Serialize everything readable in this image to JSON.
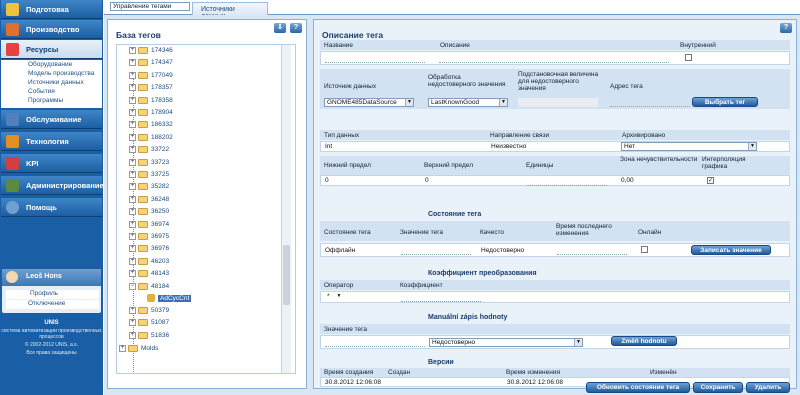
{
  "nav": {
    "items": [
      {
        "label": "Подготовка",
        "icon": "clipboard-icon",
        "color": "#f0c040"
      },
      {
        "label": "Производство",
        "icon": "tools-icon",
        "color": "#e07030"
      },
      {
        "label": "Ресурсы",
        "icon": "resources-icon",
        "color": "#e84040"
      },
      {
        "label": "Обслуживание",
        "icon": "service-icon",
        "color": "#5080c0"
      },
      {
        "label": "Технология",
        "icon": "technology-icon",
        "color": "#e09020"
      },
      {
        "label": "KPI",
        "icon": "kpi-icon",
        "color": "#d04040"
      },
      {
        "label": "Администрирование",
        "icon": "admin-icon",
        "color": "#5a8a40"
      },
      {
        "label": "Помощь",
        "icon": "help-icon",
        "color": "#6fa0d0"
      }
    ],
    "sub_items": [
      "Оборудование",
      "Модель производства",
      "Источники данных",
      "События",
      "Программы"
    ],
    "user": {
      "name": "Leoš Hons",
      "profile": "Профиль",
      "logout": "Отключение"
    },
    "footer": [
      "система автоматизации производственных процессов",
      "© 2002-2012 UNIS, a.s.",
      "Все права защищены"
    ]
  },
  "tabs": [
    "Управление тегами",
    "Источники данных"
  ],
  "tree": {
    "title": "База тегов",
    "nodes": [
      "174346",
      "174347",
      "177049",
      "178357",
      "178358",
      "178904",
      "186332",
      "188202",
      "33722",
      "33723",
      "33725",
      "35282",
      "36248",
      "36250",
      "36974",
      "36975",
      "36976",
      "46203",
      "48143",
      "48184",
      "50379",
      "51087",
      "51836"
    ],
    "child": "AdCycCnt",
    "last": "Molds"
  },
  "form": {
    "title": "Описание тега",
    "h_name": "Название",
    "h_desc": "Описание",
    "h_internal": "Внутренний",
    "h_source": "Источник данных",
    "h_invalid": "Обработка недостоверного значения",
    "h_substitute": "Подстановочная величина для недостоверного значения",
    "h_address": "Адрес тега",
    "source": "GNOME485DataSource",
    "invalid": "LastKnownGood",
    "select_tag": "Выбрать тег",
    "h_type": "Тип данных",
    "h_dir": "Направление связи",
    "h_arch": "Архивировано",
    "type": "Int",
    "dir": "Неизвестно",
    "arch": "Нет",
    "h_low": "Нижний предел",
    "h_high": "Верхний предел",
    "h_units": "Единицы",
    "h_dead": "Зона нечувствительности",
    "h_interp": "Интерполяция графика",
    "low": "0",
    "high": "0",
    "dead": "0,00",
    "state_title": "Состояние тега",
    "h_state": "Состояние тега",
    "h_value": "Значение тега",
    "h_quality": "Качесто",
    "h_last": "Время последнего изменения",
    "h_online": "Онлайн",
    "state": "Оффлайн",
    "quality": "Недостоверно",
    "write_value": "Записать значение",
    "coef_title": "Коэффициент преобразования",
    "h_op": "Оператор",
    "h_coef": "Коэффициент",
    "op": "*",
    "manual_title": "Manuální zápis hodnoty",
    "h_tagval": "Значение тега",
    "manual_quality": "Недостоверно",
    "change_btn": "Změň hodnotu",
    "ver_title": "Версии",
    "h_created": "Время создания",
    "h_creator": "Создан",
    "h_modified": "Время изменения",
    "h_modifier": "Изменён",
    "created": "30.8.2012 12:06:08",
    "modified": "30.8.2012 12:06:08",
    "btn_update": "Обновить состояние тега",
    "btn_save": "Сохранить",
    "btn_delete": "Удалить"
  }
}
